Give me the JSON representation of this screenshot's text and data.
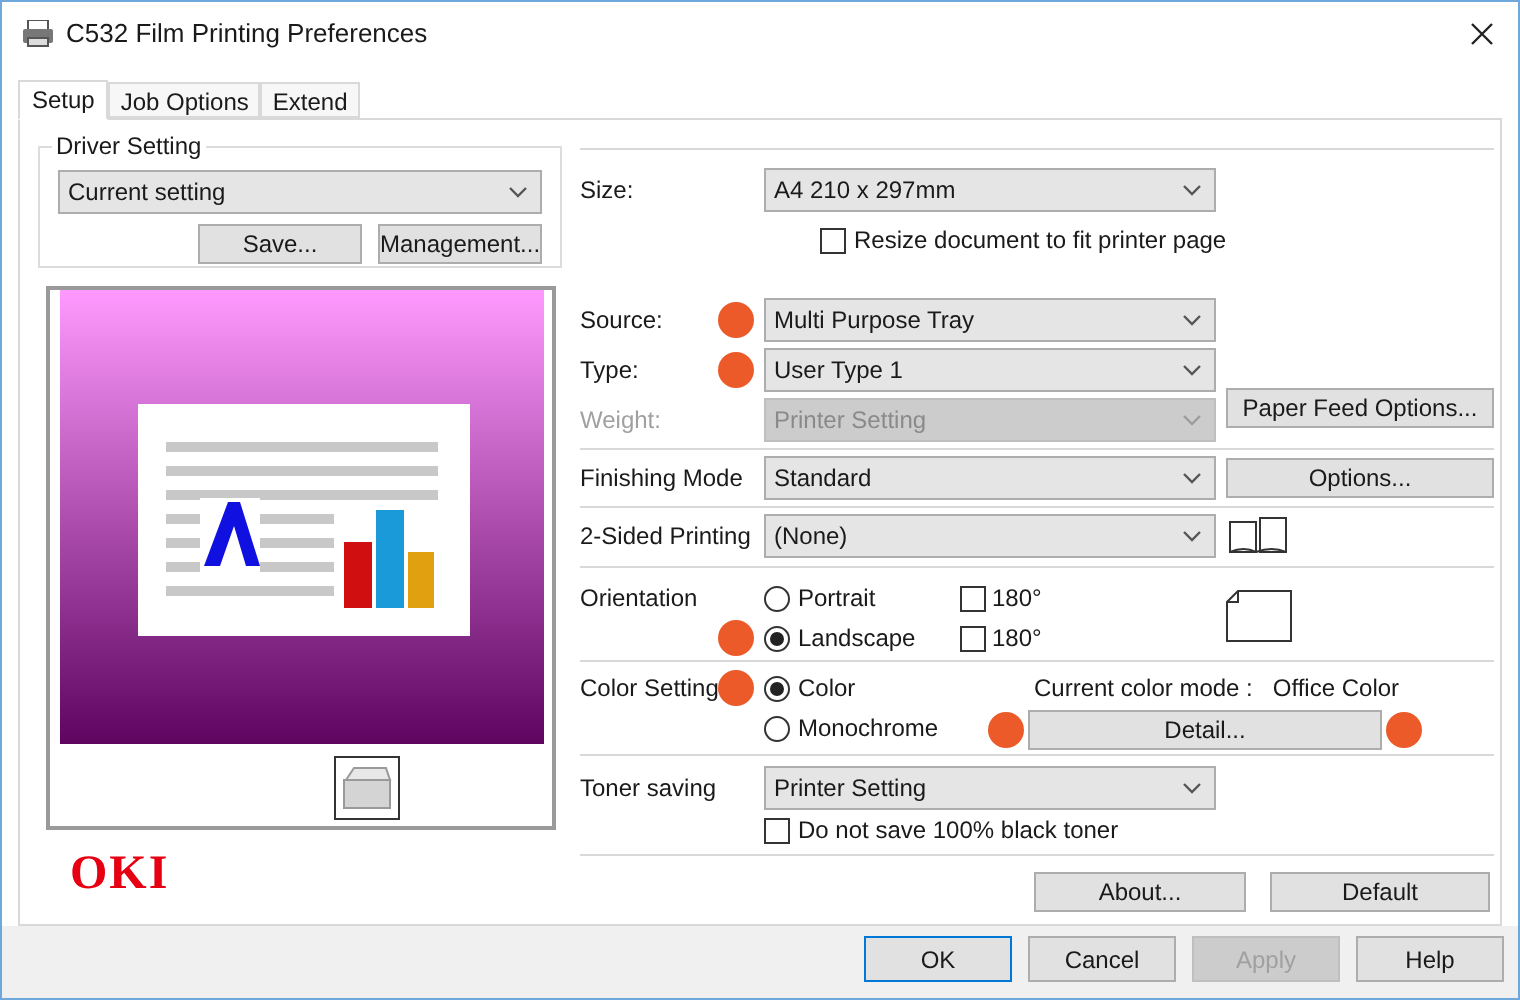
{
  "window": {
    "title": "C532 Film Printing Preferences"
  },
  "tabs": [
    {
      "label": "Setup",
      "selected": true
    },
    {
      "label": "Job Options",
      "selected": false
    },
    {
      "label": "Extend",
      "selected": false
    }
  ],
  "driver_setting": {
    "label": "Driver Setting",
    "value": "Current setting",
    "buttons": [
      "Save...",
      "Management..."
    ]
  },
  "logo": "OKI",
  "size": {
    "label": "Size:",
    "value": "A4 210 x 297mm",
    "checkbox": {
      "label": "Resize document to fit printer page",
      "checked": false
    }
  },
  "source": {
    "label": "Source:",
    "value": "Multi Purpose Tray",
    "marked": true
  },
  "type": {
    "label": "Type:",
    "value": "User Type 1",
    "marked": true
  },
  "weight": {
    "label": "Weight:",
    "value": "Printer Setting",
    "disabled": true
  },
  "paper_feed_button": "Paper Feed Options...",
  "finishing": {
    "label": "Finishing Mode",
    "value": "Standard",
    "button": "Options..."
  },
  "two_sided": {
    "label": "2-Sided Printing",
    "value": "(None)"
  },
  "orientation": {
    "label": "Orientation",
    "options": [
      {
        "label": "Portrait",
        "selected": false,
        "marked": false,
        "rotate": {
          "label": "180°",
          "checked": false
        }
      },
      {
        "label": "Landscape",
        "selected": true,
        "marked": true,
        "rotate": {
          "label": "180°",
          "checked": false
        }
      }
    ]
  },
  "color_setting": {
    "label": "Color Setting",
    "marked": true,
    "options": [
      {
        "label": "Color",
        "selected": true
      },
      {
        "label": "Monochrome",
        "selected": false
      }
    ],
    "mode_label": "Current color mode :",
    "mode_value": "Office Color",
    "detail_button": {
      "label": "Detail...",
      "marked": true
    }
  },
  "toner": {
    "label": "Toner saving",
    "value": "Printer Setting",
    "checkbox": {
      "label": "Do not save 100% black toner",
      "checked": false
    }
  },
  "info_buttons": [
    "About...",
    "Default"
  ],
  "dialog_buttons": [
    {
      "label": "OK",
      "default": true,
      "disabled": false
    },
    {
      "label": "Cancel",
      "default": false,
      "disabled": false
    },
    {
      "label": "Apply",
      "default": false,
      "disabled": true
    },
    {
      "label": "Help",
      "default": false,
      "disabled": false
    }
  ]
}
